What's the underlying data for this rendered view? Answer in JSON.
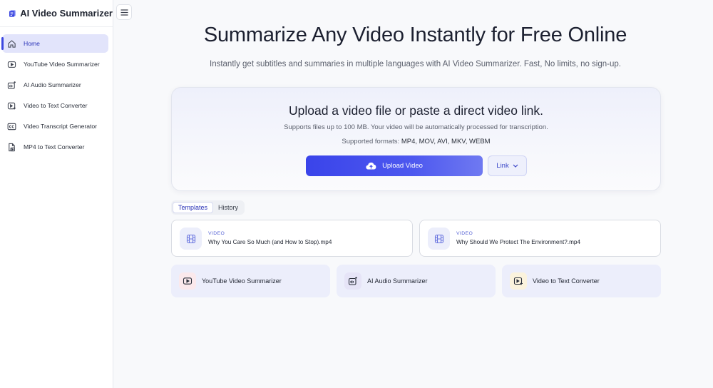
{
  "brand": {
    "title": "AI Video Summarizer",
    "accent": "#3b47e0"
  },
  "sidebar": {
    "items": [
      {
        "label": "Home",
        "icon": "home-icon",
        "active": true
      },
      {
        "label": "YouTube Video Summarizer",
        "icon": "play-icon"
      },
      {
        "label": "AI Audio Summarizer",
        "icon": "audio-sparkle-icon"
      },
      {
        "label": "Video to Text Converter",
        "icon": "video-text-icon"
      },
      {
        "label": "Video Transcript Generator",
        "icon": "cc-icon"
      },
      {
        "label": "MP4 to Text Converter",
        "icon": "file-video-icon"
      }
    ]
  },
  "hero": {
    "title": "Summarize Any Video Instantly for Free Online",
    "subtitle": "Instantly get subtitles and summaries in multiple languages with AI Video Summarizer. Fast, No limits, no sign-up."
  },
  "upload": {
    "title": "Upload a video file or paste a direct video link.",
    "note": "Supports files up to 100 MB. Your video will be automatically processed for transcription.",
    "formats_label": "Supported formats:",
    "formats_value": "MP4, MOV, AVI, MKV, WEBM",
    "button_label": "Upload Video",
    "link_label": "Link"
  },
  "tabs": [
    {
      "label": "Templates",
      "active": true
    },
    {
      "label": "History",
      "active": false
    }
  ],
  "videos": [
    {
      "tag": "VIDEO",
      "name": "Why You Care So Much (and How to Stop).mp4"
    },
    {
      "tag": "VIDEO",
      "name": "Why Should We Protect The Environment?.mp4"
    }
  ],
  "tools": [
    {
      "label": "YouTube Video Summarizer",
      "icon": "play-icon",
      "icon_bg": "#fbe9ec"
    },
    {
      "label": "AI Audio Summarizer",
      "icon": "audio-sparkle-icon",
      "icon_bg": "#e6e4f7"
    },
    {
      "label": "Video to Text Converter",
      "icon": "video-text-icon",
      "icon_bg": "#fbf3dd"
    }
  ]
}
